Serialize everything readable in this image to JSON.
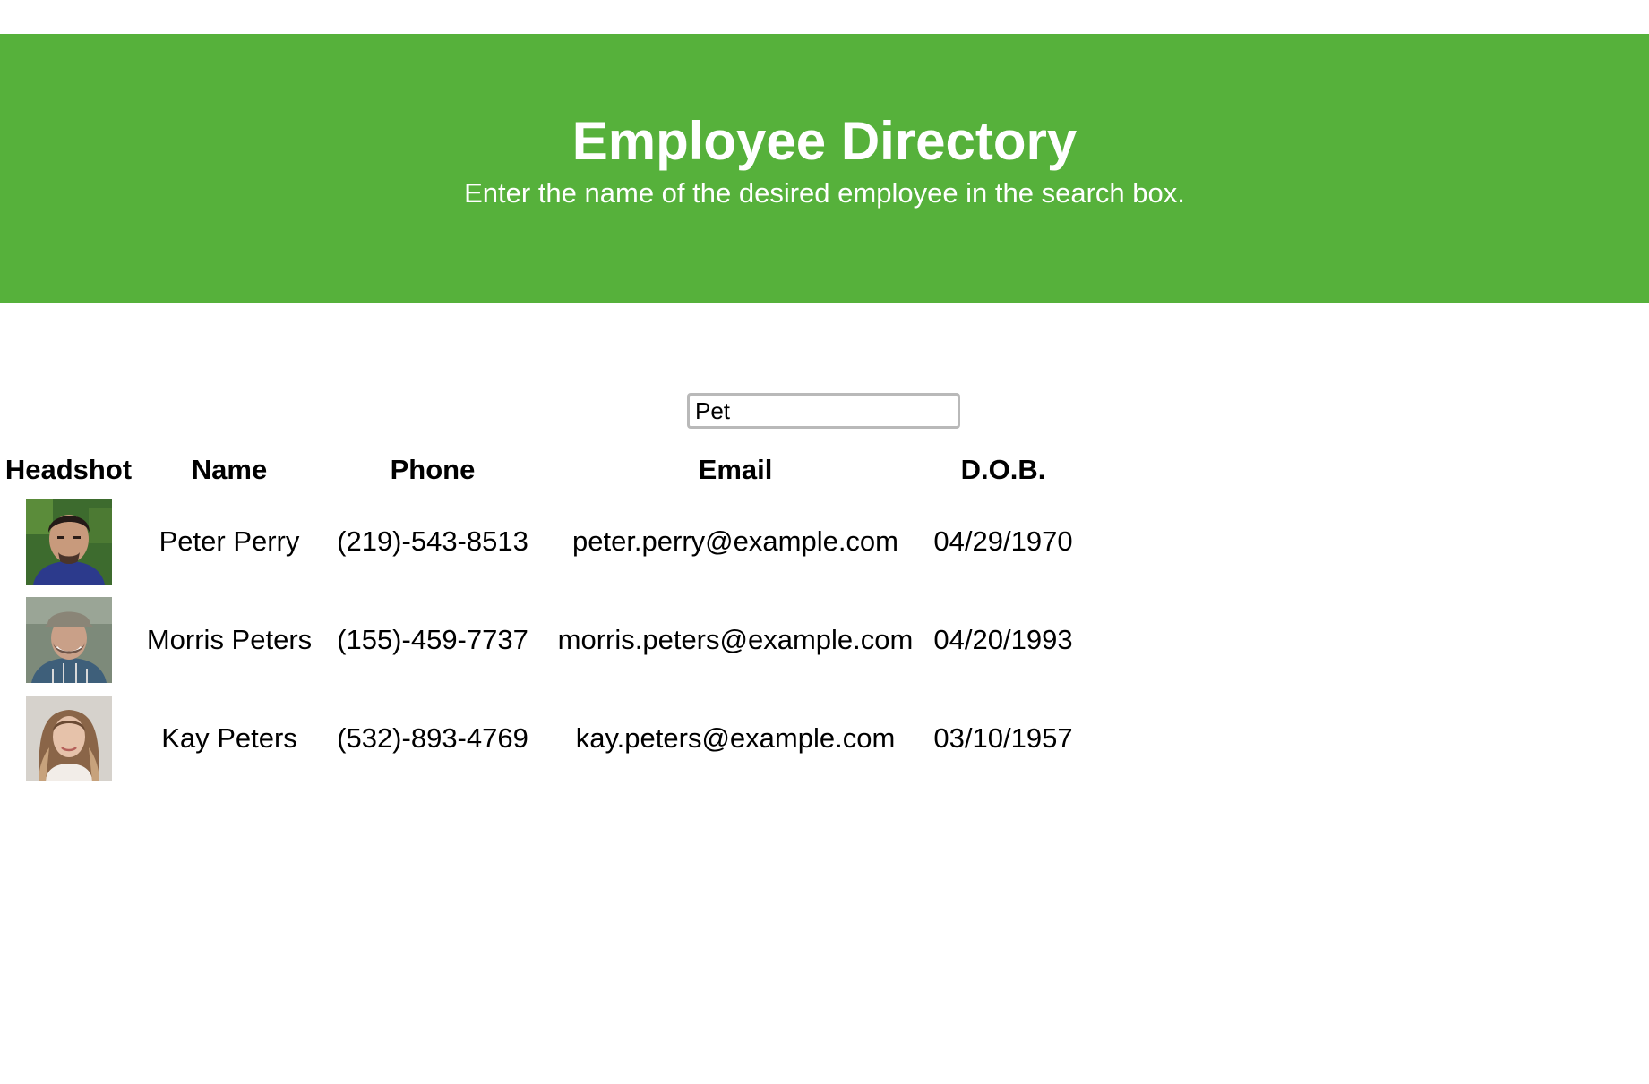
{
  "header": {
    "title": "Employee Directory",
    "subtitle": "Enter the name of the desired employee in the search box.",
    "background_color": "#56b13b"
  },
  "search": {
    "value": "Pet",
    "placeholder": ""
  },
  "table": {
    "columns": [
      "Headshot",
      "Name",
      "Phone",
      "Email",
      "D.O.B."
    ],
    "rows": [
      {
        "headshot": "photo-man-dark-hair-goatee",
        "name": "Peter Perry",
        "phone": "(219)-543-8513",
        "email": "peter.perry@example.com",
        "dob": "04/29/1970"
      },
      {
        "headshot": "photo-man-cap-plaid-shirt",
        "name": "Morris Peters",
        "phone": "(155)-459-7737",
        "email": "morris.peters@example.com",
        "dob": "04/20/1993"
      },
      {
        "headshot": "photo-woman-long-wavy-hair",
        "name": "Kay Peters",
        "phone": "(532)-893-4769",
        "email": "kay.peters@example.com",
        "dob": "03/10/1957"
      }
    ]
  }
}
